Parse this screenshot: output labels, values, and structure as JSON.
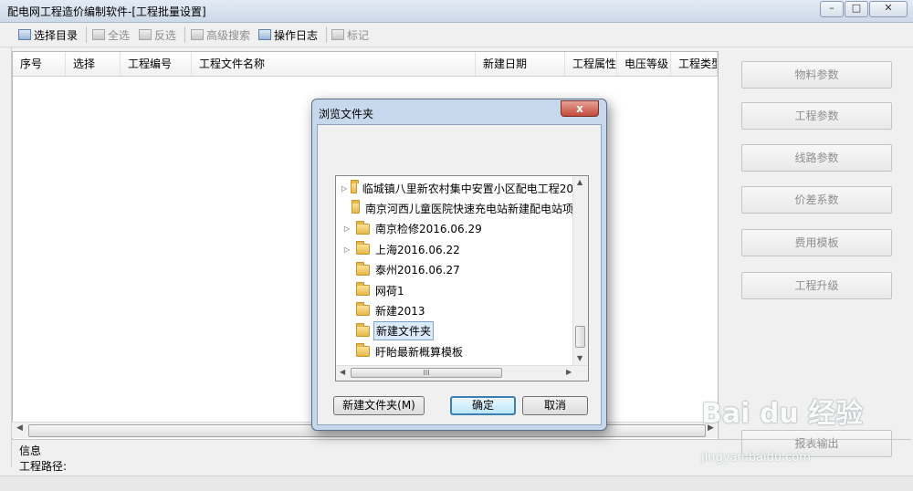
{
  "window": {
    "title": "配电网工程造价编制软件-[工程批量设置]"
  },
  "toolbar": {
    "select_dir": "选择目录",
    "select_all": "全选",
    "invert": "反选",
    "adv_search": "高级搜索",
    "op_log": "操作日志",
    "mark": "标记"
  },
  "grid": {
    "columns": [
      "序号",
      "选择",
      "工程编号",
      "工程文件名称",
      "新建日期",
      "工程属性",
      "电压等级",
      "工程类型"
    ]
  },
  "right_buttons": [
    "物料参数",
    "工程参数",
    "线路参数",
    "价差系数",
    "费用模板",
    "工程升级",
    "报表输出"
  ],
  "info": {
    "label": "信息",
    "path_label": "工程路径:"
  },
  "dialog": {
    "title": "浏览文件夹",
    "close": "x",
    "folders": [
      {
        "name": "临城镇八里新农村集中安置小区配电工程20",
        "expandable": true,
        "selected": false
      },
      {
        "name": "南京河西儿童医院快速充电站新建配电站项",
        "expandable": false,
        "selected": false
      },
      {
        "name": "南京检修2016.06.29",
        "expandable": true,
        "selected": false
      },
      {
        "name": "上海2016.06.22",
        "expandable": true,
        "selected": false
      },
      {
        "name": "泰州2016.06.27",
        "expandable": false,
        "selected": false
      },
      {
        "name": "网荷1",
        "expandable": false,
        "selected": false
      },
      {
        "name": "新建2013",
        "expandable": false,
        "selected": false
      },
      {
        "name": "新建文件夹",
        "expandable": false,
        "selected": true
      },
      {
        "name": "盱眙最新概算模板",
        "expandable": false,
        "selected": false
      }
    ],
    "new_folder": "新建文件夹(M)",
    "ok": "确定",
    "cancel": "取消"
  },
  "watermark": {
    "brand": "Bai du 经验",
    "url": "jingyan.baidu.com"
  }
}
